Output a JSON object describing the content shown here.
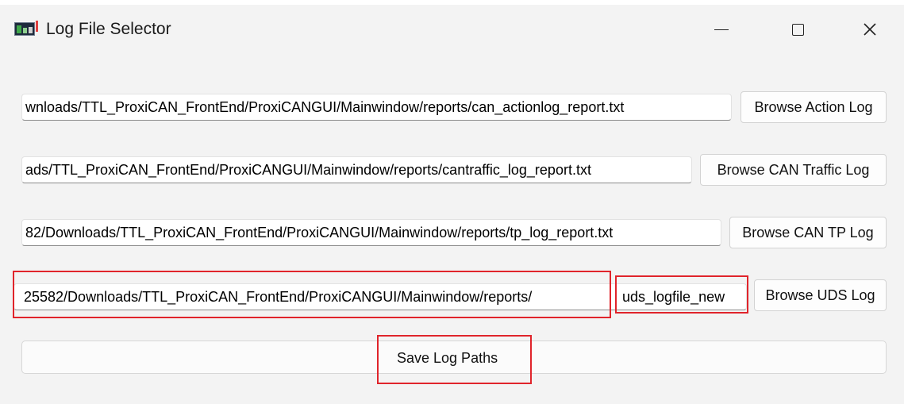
{
  "window": {
    "title": "Log File Selector",
    "icon": "app-chart-icon",
    "controls": {
      "minimize": "minimize-icon",
      "maximize": "maximize-icon",
      "close": "close-icon"
    },
    "close_glyph": "✕"
  },
  "rows": [
    {
      "path_visible": "wnloads/TTL_ProxiCAN_FrontEnd/ProxiCANGUI/Mainwindow/reports/can_actionlog_report.txt",
      "button": "Browse Action Log"
    },
    {
      "path_visible": "ads/TTL_ProxiCAN_FrontEnd/ProxiCANGUI/Mainwindow/reports/cantraffic_log_report.txt",
      "button": "Browse CAN Traffic Log"
    },
    {
      "path_visible": "82/Downloads/TTL_ProxiCAN_FrontEnd/ProxiCANGUI/Mainwindow/reports/tp_log_report.txt",
      "button": "Browse CAN TP Log"
    },
    {
      "path_visible": "25582/Downloads/TTL_ProxiCAN_FrontEnd/ProxiCANGUI/Mainwindow/reports/uds_logfile_new",
      "button": "Browse UDS Log"
    }
  ],
  "uds_split": {
    "left": "25582/Downloads/TTL_ProxiCAN_FrontEnd/ProxiCANGUI/Mainwindow/reports/",
    "right": "uds_logfile_new"
  },
  "save_button": "Save Log Paths",
  "highlight_color": "#e0242b"
}
